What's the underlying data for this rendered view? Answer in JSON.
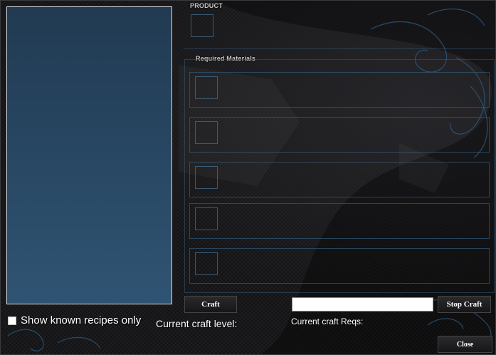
{
  "product_section": {
    "label": "PRODUCT"
  },
  "materials_section": {
    "label": "Required Materials",
    "slot_count": 5
  },
  "buttons": {
    "craft": "Craft",
    "stop_craft": "Stop Craft",
    "close": "Close"
  },
  "craft_input": {
    "value": "",
    "placeholder": ""
  },
  "show_known": {
    "label": "Show known recipes only",
    "checked": false
  },
  "current_craft_level": {
    "label": "Current craft level:"
  },
  "current_craft_reqs": {
    "label": "Current craft Reqs:"
  },
  "colors": {
    "list_top": "#213a52",
    "list_bottom": "#2f5473",
    "accent": "#3a6a94"
  }
}
